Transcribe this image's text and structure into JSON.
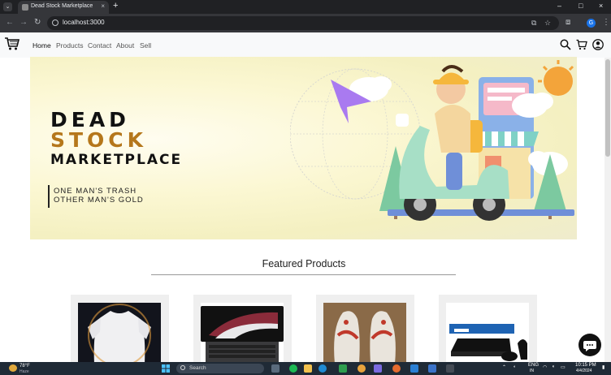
{
  "browser": {
    "tab_menu_icon": "chevron-down-icon",
    "tab_title": "Dead Stock Marketplace",
    "tab_close": "×",
    "new_tab": "+",
    "url": "localhost:3000",
    "profile_initial": "G",
    "win_controls": [
      "–",
      "□",
      "×"
    ]
  },
  "site": {
    "nav": {
      "links": [
        "Home",
        "Products",
        "Contact",
        "About",
        "Sell"
      ],
      "active": "Home"
    },
    "hero": {
      "line1": "DEAD",
      "line2": "STOCK",
      "line3": "MARKETPLACE",
      "tagline1": "ONE MAN'S TRASH",
      "tagline2": "OTHER MAN'S GOLD"
    },
    "featured_title": "Featured Products",
    "products": [
      {
        "image": "white-tshirt"
      },
      {
        "image": "laptop"
      },
      {
        "image": "sneakers"
      },
      {
        "image": "ps4-console"
      }
    ]
  },
  "taskbar": {
    "weather_temp": "78°F",
    "weather_desc": "Haze",
    "search_label": "Search",
    "lang": "ENG",
    "lang2": "IN",
    "time": "10:15 PM",
    "date": "4/4/2024"
  },
  "colors": {
    "accent_gold": "#b5771b",
    "nav_bg": "#f8f9fa",
    "hero_bg": "#f4f0c1"
  }
}
